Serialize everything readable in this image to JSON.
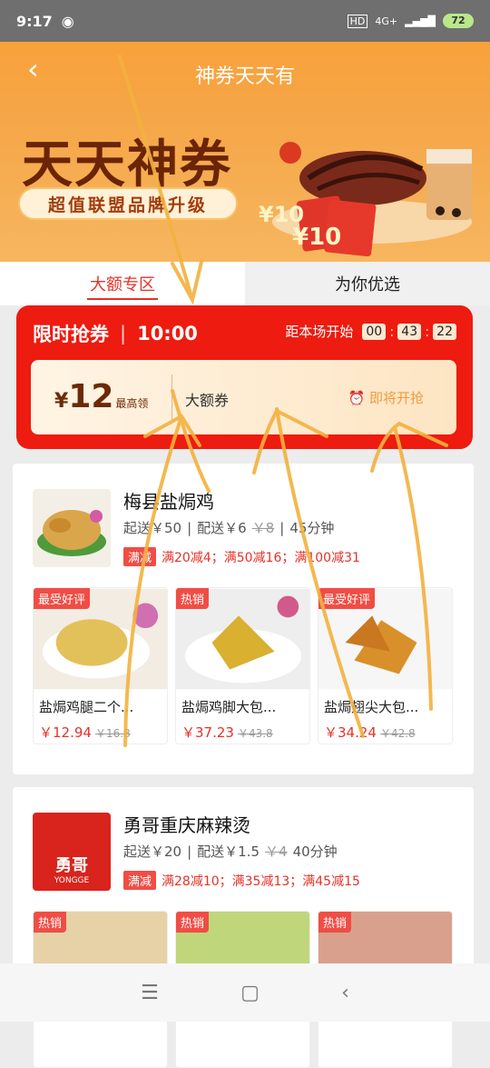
{
  "status": {
    "time": "9:17",
    "net": "4G+",
    "battery": "72"
  },
  "header": {
    "title": "神券天天有",
    "back_icon": "chevron-left-icon"
  },
  "banner": {
    "headline": "天天神券",
    "subtitle": "超值联盟品牌升级",
    "coupon_text_1": "¥10",
    "coupon_text_2": "¥10"
  },
  "tabs": [
    {
      "label": "大额专区"
    },
    {
      "label": "为你优选"
    }
  ],
  "flash": {
    "label": "限时抢券",
    "time": "10:00",
    "countdown_label": "距本场开始",
    "h": "00",
    "m": "43",
    "s": "22",
    "coupon": {
      "currency": "¥",
      "amount": "12",
      "note": "最高领",
      "name": "大额券",
      "action": "即将开抢"
    }
  },
  "shops": [
    {
      "name": "梅县盐焗鸡",
      "min": "起送￥50",
      "delivery": "配送￥6",
      "delivery_orig": "￥8",
      "time": "45分钟",
      "promo_tag": "满减",
      "promos": "满20减4；满50减16；满100减31",
      "goods": [
        {
          "badge": "最受好评",
          "name": "盐焗鸡腿二个...",
          "price": "￥12.94",
          "orig": "￥16.8"
        },
        {
          "badge": "热销",
          "name": "盐焗鸡脚大包...",
          "price": "￥37.23",
          "orig": "￥43.8"
        },
        {
          "badge": "最受好评",
          "name": "盐焗翅尖大包...",
          "price": "￥34.24",
          "orig": "￥42.8"
        }
      ]
    },
    {
      "name": "勇哥重庆麻辣烫",
      "min": "起送￥20",
      "delivery": "配送￥1.5",
      "delivery_orig": "￥4",
      "time": "40分钟",
      "promo_tag": "满减",
      "promos": "满28减10；满35减13；满45减15",
      "logo_text": "勇哥",
      "logo_sub": "YONGGE",
      "goods": [
        {
          "badge": "热销"
        },
        {
          "badge": "热销"
        },
        {
          "badge": "热销"
        }
      ]
    }
  ],
  "colors": {
    "accent": "#e53228",
    "banner": "#f7a93f",
    "flash": "#ee1b10"
  }
}
